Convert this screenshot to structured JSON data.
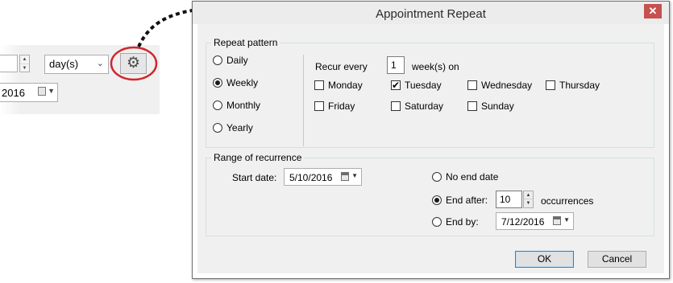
{
  "background": {
    "unit_select": {
      "value": "day(s)"
    },
    "date_fragment": "2016",
    "gear_icon": "gear-icon"
  },
  "dialog": {
    "title": "Appointment Repeat",
    "close_label": "✕",
    "repeat_pattern": {
      "title": "Repeat pattern",
      "options": [
        {
          "label": "Daily",
          "selected": false
        },
        {
          "label": "Weekly",
          "selected": true
        },
        {
          "label": "Monthly",
          "selected": false
        },
        {
          "label": "Yearly",
          "selected": false
        }
      ],
      "recur_label": "Recur every",
      "recur_value": "1",
      "recur_suffix": "week(s) on",
      "days": [
        {
          "label": "Monday",
          "checked": false
        },
        {
          "label": "Tuesday",
          "checked": true
        },
        {
          "label": "Wednesday",
          "checked": false
        },
        {
          "label": "Thursday",
          "checked": false
        },
        {
          "label": "Friday",
          "checked": false
        },
        {
          "label": "Saturday",
          "checked": false
        },
        {
          "label": "Sunday",
          "checked": false
        }
      ]
    },
    "range": {
      "title": "Range of recurrence",
      "start_label": "Start date:",
      "start_value": "5/10/2016",
      "no_end_label": "No end date",
      "end_after_label": "End after:",
      "end_after_value": "10",
      "occurrences_label": "occurrences",
      "end_by_label": "End by:",
      "end_by_value": "7/12/2016",
      "selected": "end_after"
    },
    "ok_label": "OK",
    "cancel_label": "Cancel"
  },
  "colors": {
    "annotation_circle": "#d0262d",
    "close_button": "#c75050"
  }
}
